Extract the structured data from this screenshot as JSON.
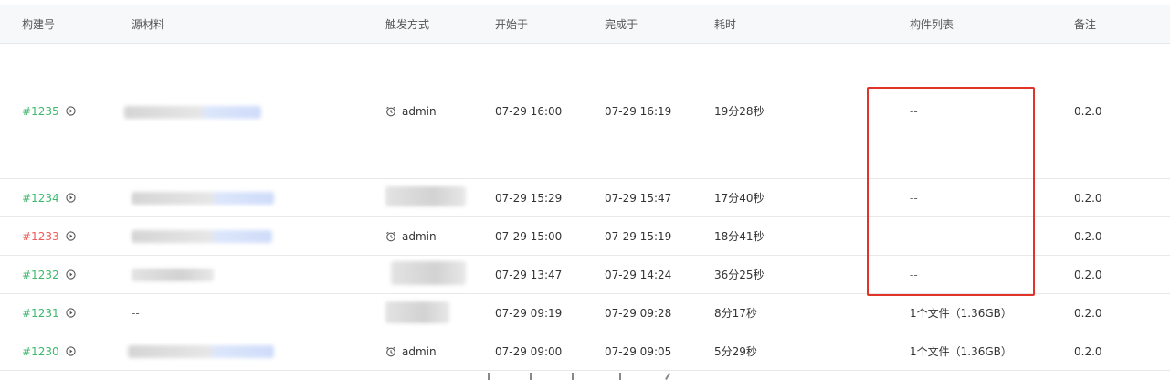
{
  "table": {
    "columns": [
      "构建号",
      "源材料",
      "触发方式",
      "开始于",
      "完成于",
      "耗时",
      "构件列表",
      "备注"
    ],
    "rows": [
      {
        "build": "#1235",
        "status": "success",
        "trigger": "admin",
        "start": "07-29 16:00",
        "end": "07-29 16:19",
        "duration": "19分28秒",
        "artifacts": "--",
        "note": "0.2.0"
      },
      {
        "build": "#1234",
        "status": "success",
        "trigger": "",
        "start": "07-29 15:29",
        "end": "07-29 15:47",
        "duration": "17分40秒",
        "artifacts": "--",
        "note": "0.2.0"
      },
      {
        "build": "#1233",
        "status": "failed",
        "trigger": "admin",
        "start": "07-29 15:00",
        "end": "07-29 15:19",
        "duration": "18分41秒",
        "artifacts": "--",
        "note": "0.2.0"
      },
      {
        "build": "#1232",
        "status": "success",
        "trigger": "",
        "start": "07-29 13:47",
        "end": "07-29 14:24",
        "duration": "36分25秒",
        "artifacts": "--",
        "note": "0.2.0"
      },
      {
        "build": "#1231",
        "status": "success",
        "source": "--",
        "trigger": "",
        "start": "07-29 09:19",
        "end": "07-29 09:28",
        "duration": "8分17秒",
        "artifacts": "1个文件（1.36GB）",
        "note": "0.2.0"
      },
      {
        "build": "#1230",
        "status": "success",
        "trigger": "admin",
        "start": "07-29 09:00",
        "end": "07-29 09:05",
        "duration": "5分29秒",
        "artifacts": "1个文件（1.36GB）",
        "note": "0.2.0"
      }
    ]
  },
  "colors": {
    "success": "#3eb96e",
    "failed": "#f05a5a",
    "highlight": "#e0332a"
  },
  "icons": {
    "build_action": "play-circle-icon",
    "trigger": "alarm-clock-icon"
  }
}
